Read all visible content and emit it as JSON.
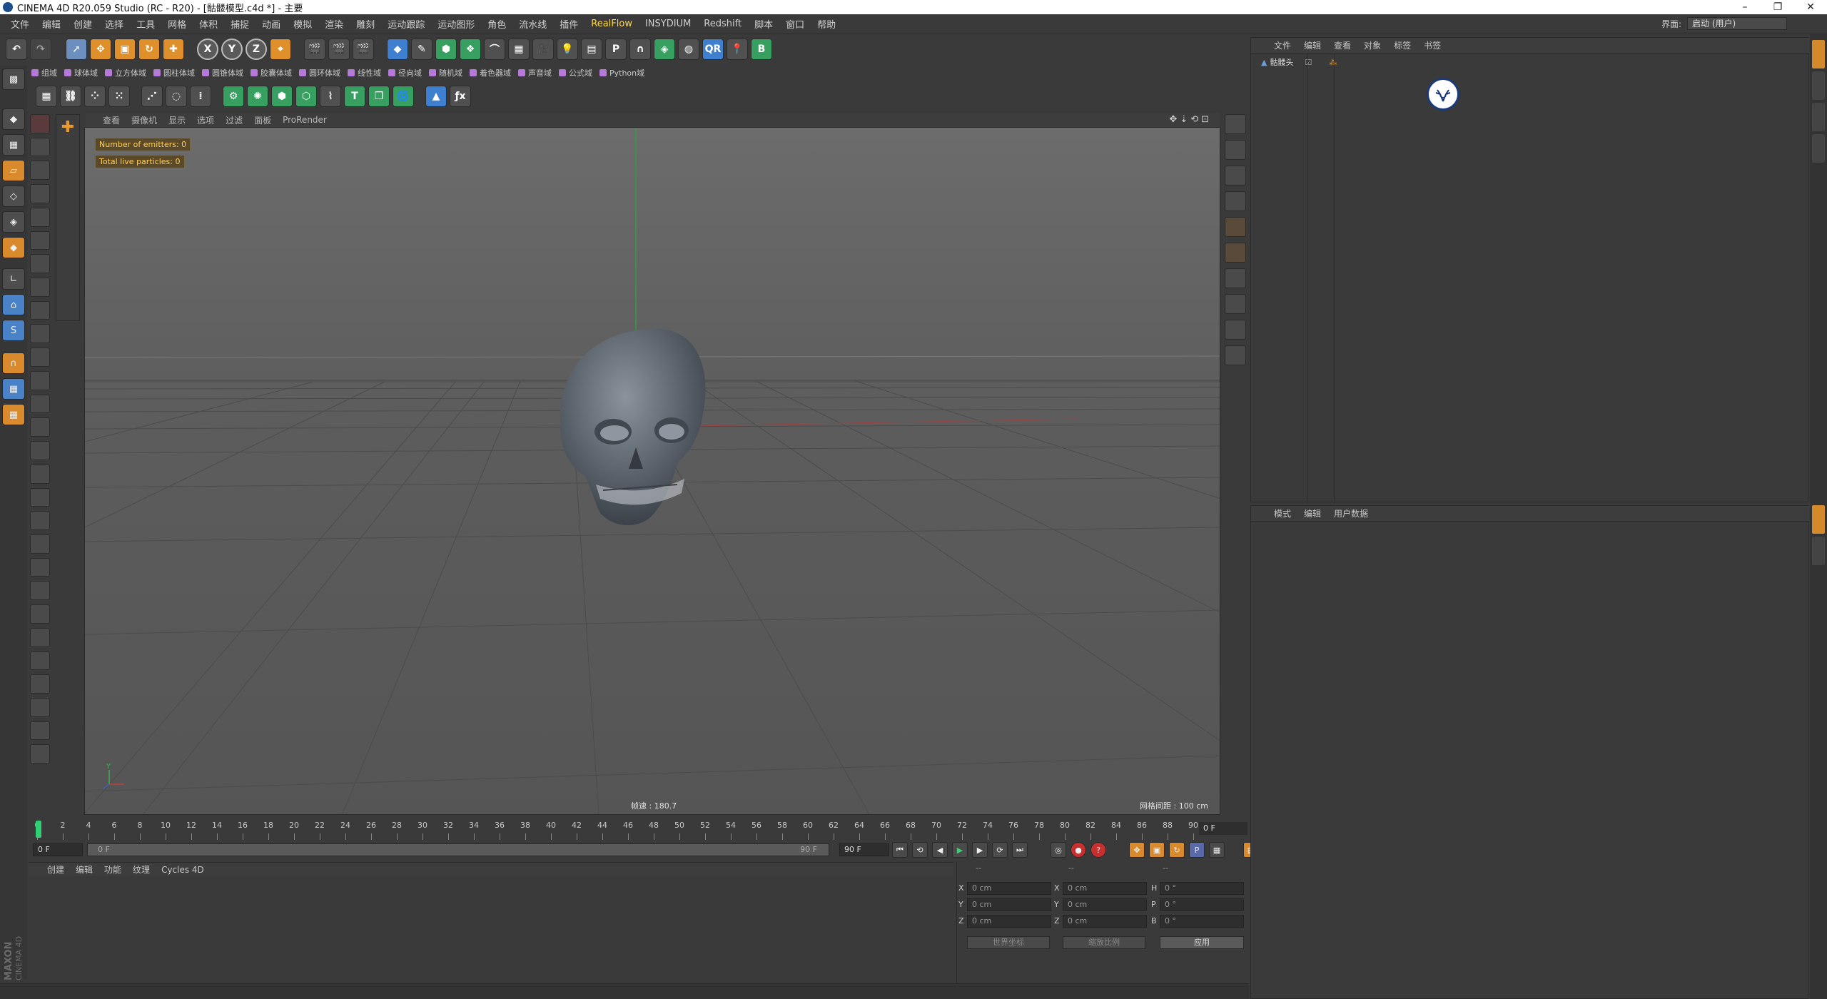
{
  "window": {
    "title": "CINEMA 4D R20.059 Studio (RC - R20) - [骷髅模型.c4d *] - 主要",
    "controls": [
      "–",
      "❐",
      "✕"
    ]
  },
  "menubar": {
    "items": [
      "文件",
      "编辑",
      "创建",
      "选择",
      "工具",
      "网格",
      "体积",
      "捕捉",
      "动画",
      "模拟",
      "渲染",
      "雕刻",
      "运动跟踪",
      "运动图形",
      "角色",
      "流水线",
      "插件",
      "RealFlow",
      "INSYDIUM",
      "Redshift",
      "脚本",
      "窗口",
      "帮助"
    ],
    "layout_label": "界面:",
    "layout_value": "启动 (用户)"
  },
  "main_toolbar": {
    "undo": "↶",
    "redo": "↷",
    "axis_x": "X",
    "axis_y": "Y",
    "axis_z": "Z"
  },
  "object_toolbar": {
    "items": [
      "组域",
      "球体域",
      "立方体域",
      "圆柱体域",
      "圆锥体域",
      "胶囊体域",
      "圆环体域",
      "线性域",
      "径向域",
      "随机域",
      "着色器域",
      "声音域",
      "公式域",
      "Python域"
    ]
  },
  "viewport": {
    "menu": [
      "查看",
      "摄像机",
      "显示",
      "选项",
      "过滤",
      "面板",
      "ProRender"
    ],
    "ctrls": "✥⇣⟲⊡",
    "hud_emitters": "Number of emitters: 0",
    "hud_particles": "Total live particles: 0",
    "speed": "帧速 : 180.7",
    "grid_spacing": "网格间距 : 100 cm",
    "axis_y": "Y"
  },
  "timeline": {
    "ticks": [
      "0",
      "2",
      "4",
      "6",
      "8",
      "10",
      "12",
      "14",
      "16",
      "18",
      "20",
      "22",
      "24",
      "26",
      "28",
      "30",
      "32",
      "34",
      "36",
      "38",
      "40",
      "42",
      "44",
      "46",
      "48",
      "50",
      "52",
      "54",
      "56",
      "58",
      "60",
      "62",
      "64",
      "66",
      "68",
      "70",
      "72",
      "74",
      "76",
      "78",
      "80",
      "82",
      "84",
      "86",
      "88",
      "90"
    ],
    "current_frame": "0 F"
  },
  "transport": {
    "start": "0 F",
    "range_start": "0 F",
    "range_end": "90 F",
    "end": "90 F"
  },
  "material_manager": {
    "menu": [
      "创建",
      "编辑",
      "功能",
      "纹理",
      "Cycles 4D"
    ]
  },
  "coordinates": {
    "headers": [
      "--",
      "--",
      "--"
    ],
    "rows": [
      {
        "l1": "X",
        "v1": "0 cm",
        "l2": "X",
        "v2": "0 cm",
        "l3": "H",
        "v3": "0 °"
      },
      {
        "l1": "Y",
        "v1": "0 cm",
        "l2": "Y",
        "v2": "0 cm",
        "l3": "P",
        "v3": "0 °"
      },
      {
        "l1": "Z",
        "v1": "0 cm",
        "l2": "Z",
        "v2": "0 cm",
        "l3": "B",
        "v3": "0 °"
      }
    ],
    "mode_select": "世界坐标",
    "scale_select": "缩放比例",
    "apply": "应用"
  },
  "object_manager": {
    "menu": [
      "文件",
      "编辑",
      "查看",
      "对象",
      "标签",
      "书签"
    ],
    "object_name": "骷髅头"
  },
  "attribute_manager": {
    "menu": [
      "模式",
      "编辑",
      "用户数据"
    ]
  },
  "logo": {
    "text1": "MAXON",
    "text2": "CINEMA 4D"
  },
  "colors": {
    "accent_yellow": "#ffd84a",
    "timeline_cursor": "#2fd075",
    "tab_orange": "#d48a2a"
  }
}
